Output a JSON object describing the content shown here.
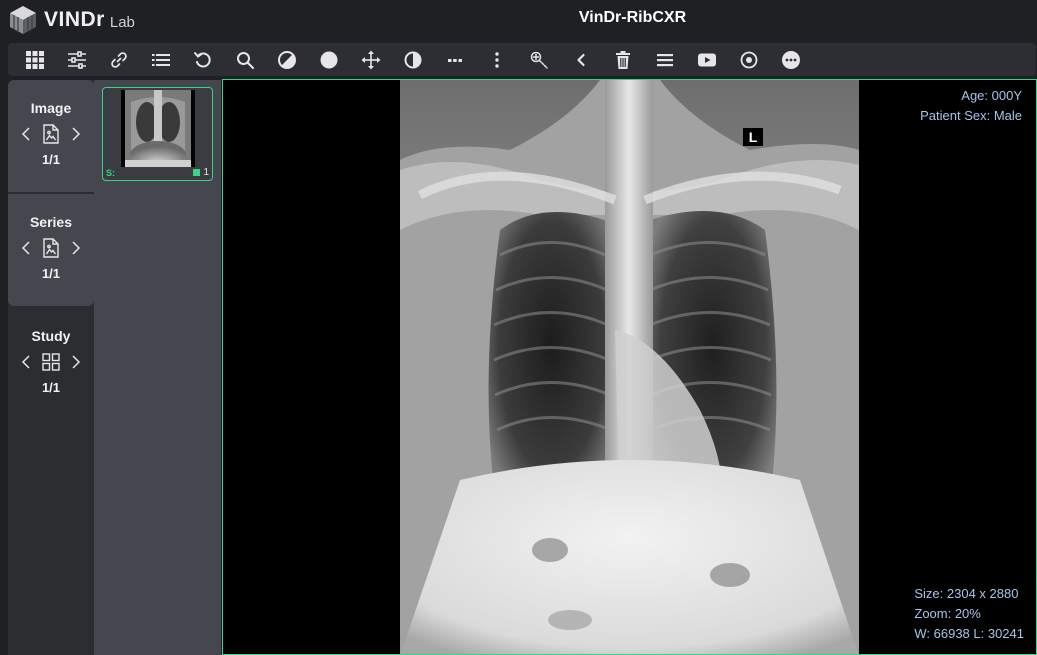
{
  "header": {
    "logo_text": "VINDr",
    "logo_sub": "Lab",
    "title": "VinDr-RibCXR"
  },
  "toolbar": {
    "tools": [
      {
        "name": "layout-grid-icon"
      },
      {
        "name": "sliders-icon"
      },
      {
        "name": "link-icon"
      },
      {
        "name": "list-icon"
      },
      {
        "name": "reset-icon"
      },
      {
        "name": "zoom-icon"
      },
      {
        "name": "window-level-icon"
      },
      {
        "name": "circle-icon"
      },
      {
        "name": "pan-icon"
      },
      {
        "name": "invert-icon"
      },
      {
        "name": "more-horizontal-icon"
      },
      {
        "name": "more-vertical-icon"
      },
      {
        "name": "magic-wand-icon"
      },
      {
        "name": "chevron-left-icon"
      },
      {
        "name": "trash-icon"
      },
      {
        "name": "menu-icon"
      },
      {
        "name": "cine-play-icon"
      },
      {
        "name": "target-icon"
      },
      {
        "name": "ellipsis-circle-icon"
      }
    ]
  },
  "nav": {
    "image": {
      "title": "Image",
      "count": "1/1",
      "icon": "file-image-icon"
    },
    "series": {
      "title": "Series",
      "count": "1/1",
      "icon": "file-image-icon"
    },
    "study": {
      "title": "Study",
      "count": "1/1",
      "icon": "grid-icon"
    }
  },
  "thumbnail": {
    "series_label": "S:",
    "count": "1"
  },
  "overlay": {
    "age": "Age: 000Y",
    "sex": "Patient Sex: Male",
    "size": "Size: 2304 x 2880",
    "zoom": "Zoom: 20%",
    "wl": "W: 66938 L: 30241",
    "laterality_marker": "L"
  },
  "colors": {
    "accent": "#3fd08a",
    "overlay_text": "#a9c4e8",
    "panel": "#44474e",
    "background": "#1f2024"
  }
}
